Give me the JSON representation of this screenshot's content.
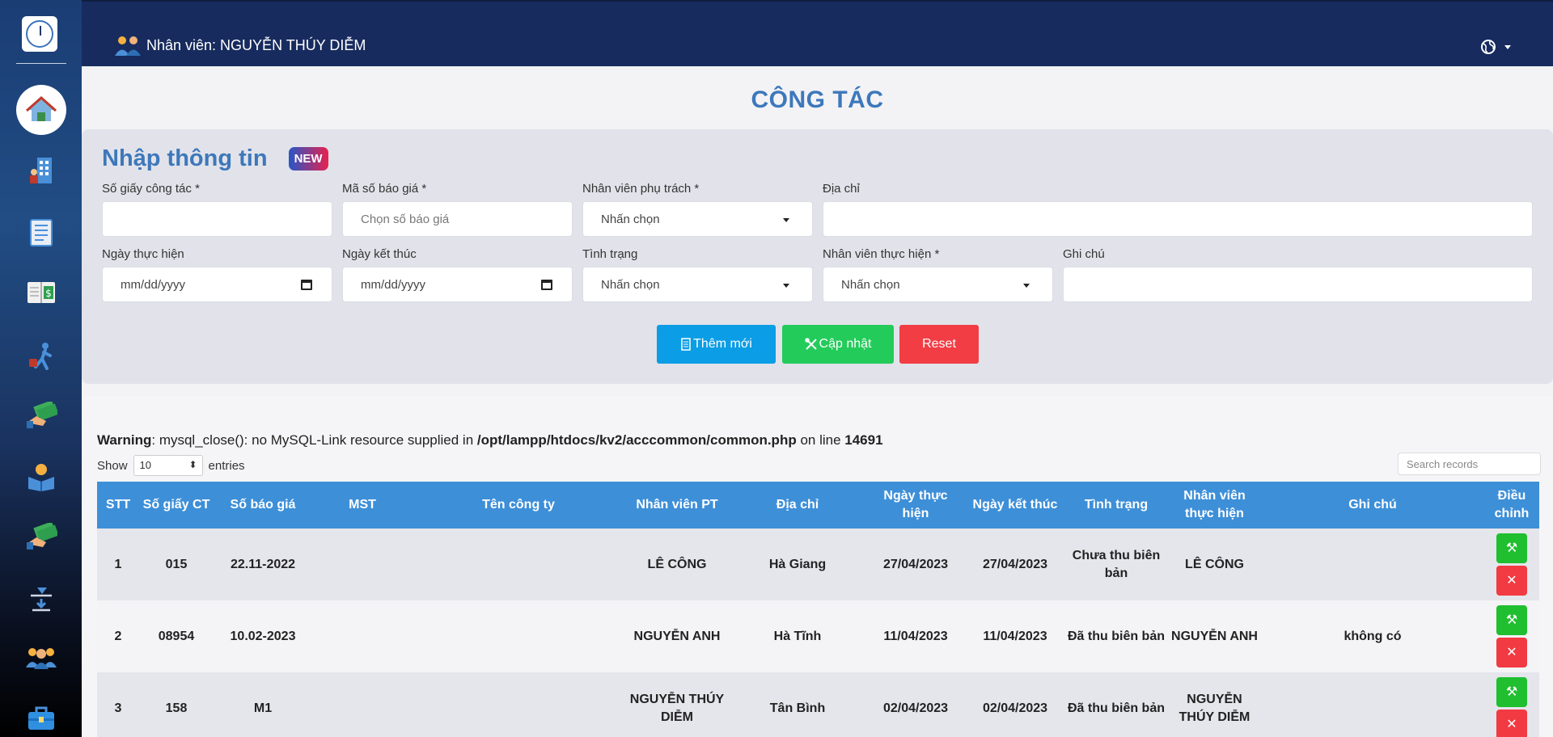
{
  "header": {
    "user_label": "Nhân viên: NGUYỄN THÚY DIỄM"
  },
  "sidebar": {
    "items": [
      {
        "name": "home-icon"
      },
      {
        "name": "building-icon"
      },
      {
        "name": "document-list-icon"
      },
      {
        "name": "ledger-money-icon"
      },
      {
        "name": "travel-icon"
      },
      {
        "name": "money-hand-icon"
      },
      {
        "name": "reader-icon"
      },
      {
        "name": "money-hand-2-icon"
      },
      {
        "name": "sign-icon"
      },
      {
        "name": "team-icon"
      },
      {
        "name": "toolbox-icon"
      }
    ]
  },
  "page": {
    "title": "CÔNG TÁC"
  },
  "form": {
    "heading": "Nhập thông tin",
    "badge": "NEW",
    "fields": {
      "so_giay": {
        "label": "Số giấy công tác *",
        "value": ""
      },
      "ma_so_bao_gia": {
        "label": "Mã số báo giá *",
        "placeholder": "Chọn số báo giá"
      },
      "nv_phu_trach": {
        "label": "Nhân viên phụ trách *",
        "value": "Nhấn chọn"
      },
      "dia_chi": {
        "label": "Địa chỉ",
        "value": ""
      },
      "ngay_thuc_hien": {
        "label": "Ngày thực hiện",
        "value": "mm/dd/yyyy"
      },
      "ngay_ket_thuc": {
        "label": "Ngày kết thúc",
        "value": "mm/dd/yyyy"
      },
      "tinh_trang": {
        "label": "Tình trạng",
        "value": "Nhấn chọn"
      },
      "nv_thuc_hien": {
        "label": "Nhân viên thực hiện *",
        "value": "Nhấn chọn"
      },
      "ghi_chu": {
        "label": "Ghi chú",
        "value": ""
      }
    },
    "buttons": {
      "add": "Thêm mới",
      "update": "Cập nhật",
      "reset": "Reset"
    }
  },
  "warning": {
    "prefix": "Warning",
    "text": ": mysql_close(): no MySQL-Link resource supplied in ",
    "path": "/opt/lampp/htdocs/kv2/acccommon/common.php",
    "mid": " on line ",
    "line": "14691"
  },
  "table_controls": {
    "show_label": "Show",
    "page_size": "10",
    "entries_label": "entries",
    "search_placeholder": "Search records"
  },
  "table": {
    "headers": [
      "STT",
      "Số giấy CT",
      "Số báo giá",
      "MST",
      "Tên công ty",
      "Nhân viên PT",
      "Địa chỉ",
      "Ngày thực hiện",
      "Ngày kết thúc",
      "Tình trạng",
      "Nhân viên thực hiện",
      "Ghi chú",
      "Điều chỉnh"
    ],
    "rows": [
      {
        "stt": "1",
        "so_giay": "015",
        "so_bao_gia": "22.11-2022",
        "mst": "",
        "ten_cong_ty": "",
        "nv_pt": "LÊ CÔNG",
        "dia_chi": "Hà Giang",
        "ngay_th": "27/04/2023",
        "ngay_kt": "27/04/2023",
        "tinh_trang": "Chưa thu biên bản",
        "nv_th": "LÊ CÔNG",
        "ghi_chu": ""
      },
      {
        "stt": "2",
        "so_giay": "08954",
        "so_bao_gia": "10.02-2023",
        "mst": "",
        "ten_cong_ty": "",
        "nv_pt": "NGUYỄN ANH",
        "dia_chi": "Hà Tĩnh",
        "ngay_th": "11/04/2023",
        "ngay_kt": "11/04/2023",
        "tinh_trang": "Đã thu biên bản",
        "nv_th": "NGUYỄN ANH",
        "ghi_chu": "không có"
      },
      {
        "stt": "3",
        "so_giay": "158",
        "so_bao_gia": "M1",
        "mst": "",
        "ten_cong_ty": "",
        "nv_pt": "NGUYỄN THÚY DIỄM",
        "dia_chi": "Tân Bình",
        "ngay_th": "02/04/2023",
        "ngay_kt": "02/04/2023",
        "tinh_trang": "Đã thu biên bản",
        "nv_th": "NGUYỄN THÚY DIỄM",
        "ghi_chu": ""
      }
    ]
  },
  "colors": {
    "accent": "#3d78bb",
    "topbar": "#172b5e",
    "table_header": "#3d8fd8",
    "add": "#0b9de6",
    "update": "#23cb5a",
    "reset": "#f23d45"
  }
}
